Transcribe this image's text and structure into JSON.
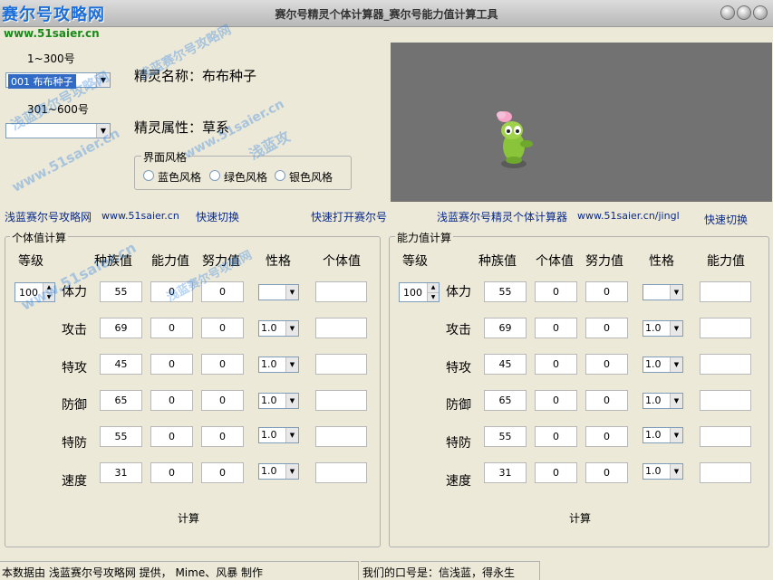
{
  "window": {
    "title": "赛尔号精灵个体计算器_赛尔号能力值计算工具",
    "logo": "赛尔号攻略网",
    "logo_url": "www.51saier.cn"
  },
  "left_panel": {
    "range1_label": "1~300号",
    "spirit_select_value": "001 布布种子",
    "range2_label": "301~600号",
    "spirit_select2_value": ""
  },
  "info": {
    "name_label": "精灵名称：",
    "name_value": "布布种子",
    "attr_label": "精灵属性：",
    "attr_value": "草系"
  },
  "theme_group": {
    "title": "界面风格",
    "options": [
      "蓝色风格",
      "绿色风格",
      "银色风格"
    ]
  },
  "links": {
    "site_name": "浅蓝赛尔号攻略网",
    "site_url": "www.51saier.cn",
    "quick_switch": "快速切换",
    "quick_open": "快速打开赛尔号",
    "calc_name": "浅蓝赛尔号精灵个体计算器",
    "calc_url": "www.51saier.cn/jingl",
    "quick_switch2": "快速切换"
  },
  "iv_calc": {
    "title": "个体值计算",
    "headers": [
      "等级",
      "种族值",
      "能力值",
      "努力值",
      "性格",
      "个体值"
    ],
    "level": "100",
    "rows": [
      {
        "label": "体力",
        "base": "55",
        "stat": "0",
        "effort": "0",
        "nature": "",
        "iv": ""
      },
      {
        "label": "攻击",
        "base": "69",
        "stat": "0",
        "effort": "0",
        "nature": "1.0",
        "iv": ""
      },
      {
        "label": "特攻",
        "base": "45",
        "stat": "0",
        "effort": "0",
        "nature": "1.0",
        "iv": ""
      },
      {
        "label": "防御",
        "base": "65",
        "stat": "0",
        "effort": "0",
        "nature": "1.0",
        "iv": ""
      },
      {
        "label": "特防",
        "base": "55",
        "stat": "0",
        "effort": "0",
        "nature": "1.0",
        "iv": ""
      },
      {
        "label": "速度",
        "base": "31",
        "stat": "0",
        "effort": "0",
        "nature": "1.0",
        "iv": ""
      }
    ],
    "calc_button": "计算"
  },
  "stat_calc": {
    "title": "能力值计算",
    "headers": [
      "等级",
      "种族值",
      "个体值",
      "努力值",
      "性格",
      "能力值"
    ],
    "level": "100",
    "rows": [
      {
        "label": "体力",
        "base": "55",
        "iv": "0",
        "effort": "0",
        "nature": "",
        "stat": ""
      },
      {
        "label": "攻击",
        "base": "69",
        "iv": "0",
        "effort": "0",
        "nature": "1.0",
        "stat": ""
      },
      {
        "label": "特攻",
        "base": "45",
        "iv": "0",
        "effort": "0",
        "nature": "1.0",
        "stat": ""
      },
      {
        "label": "防御",
        "base": "65",
        "iv": "0",
        "effort": "0",
        "nature": "1.0",
        "stat": ""
      },
      {
        "label": "特防",
        "base": "55",
        "iv": "0",
        "effort": "0",
        "nature": "1.0",
        "stat": ""
      },
      {
        "label": "速度",
        "base": "31",
        "iv": "0",
        "effort": "0",
        "nature": "1.0",
        "stat": ""
      }
    ],
    "calc_button": "计算"
  },
  "status": {
    "left": "本数据由 浅蓝赛尔号攻略网 提供， Mime、风暴 制作",
    "right": "我们的口号是：信浅蓝，得永生"
  },
  "watermarks": {
    "w1": "浅蓝赛尔号攻略网",
    "w2": "www.51saier.cn",
    "w3": "浅蓝攻"
  },
  "icons": {
    "minimize": "minimize-icon",
    "maximize": "maximize-icon",
    "close": "close-icon",
    "dropdown": "chevron-down-icon"
  }
}
